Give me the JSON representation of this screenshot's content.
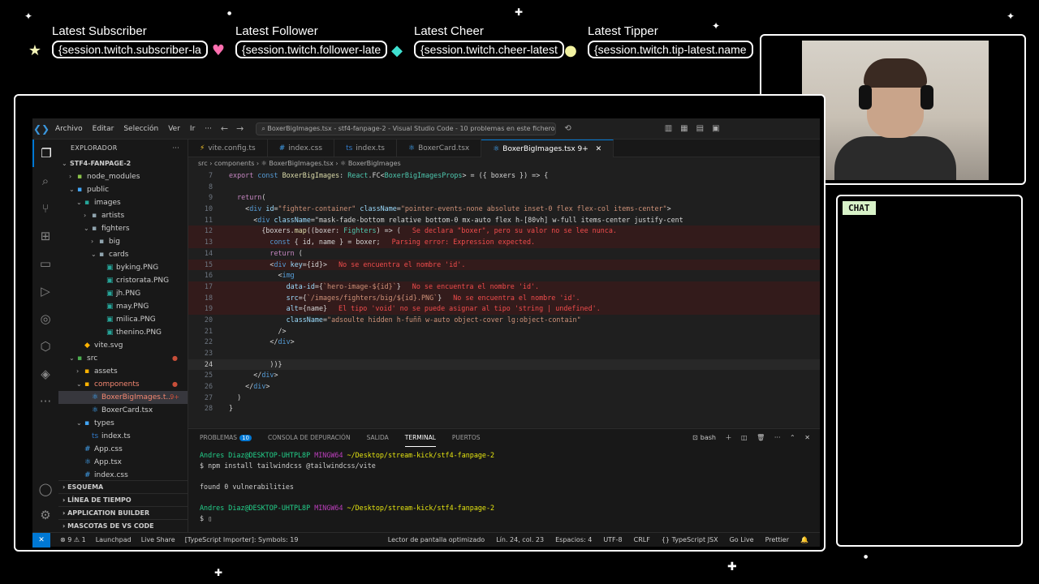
{
  "overlay": {
    "alerts": [
      {
        "label": "Latest Subscriber",
        "value": "{session.twitch.subscriber-la",
        "dot_color": "#f5f5b8",
        "dot": "★"
      },
      {
        "label": "Latest Follower",
        "value": "{session.twitch.follower-late",
        "dot_color": "#ff6fb0",
        "dot": "♥"
      },
      {
        "label": "Latest Cheer",
        "value": "{session.twitch.cheer-latest",
        "dot_color": "#3fe0d0",
        "dot": "◆"
      },
      {
        "label": "Latest Tipper",
        "value": "{session.twitch.tip-latest.name",
        "dot_color": "#f2f2a0",
        "dot": "●"
      }
    ],
    "chat_title": "CHAT"
  },
  "vscode": {
    "menu": [
      "Archivo",
      "Editar",
      "Selección",
      "Ver",
      "Ir",
      "···"
    ],
    "search": "BoxerBigImages.tsx - stf4-fanpage-2 - Visual Studio Code - 10 problemas en este fichero",
    "explorer_title": "EXPLORADOR",
    "tree": [
      {
        "depth": 0,
        "chev": "⌄",
        "icon": "",
        "label": "STF4-FANPAGE-2",
        "bold": true
      },
      {
        "depth": 1,
        "chev": "›",
        "icon": "▪",
        "label": "node_modules",
        "color": "#8bc34a"
      },
      {
        "depth": 1,
        "chev": "⌄",
        "icon": "▪",
        "label": "public",
        "color": "#42a5f5"
      },
      {
        "depth": 2,
        "chev": "⌄",
        "icon": "▪",
        "label": "images",
        "color": "#26a69a"
      },
      {
        "depth": 3,
        "chev": "›",
        "icon": "▪",
        "label": "artists",
        "color": "#90a4ae"
      },
      {
        "depth": 3,
        "chev": "⌄",
        "icon": "▪",
        "label": "fighters",
        "color": "#90a4ae"
      },
      {
        "depth": 4,
        "chev": "›",
        "icon": "▪",
        "label": "big",
        "color": "#90a4ae"
      },
      {
        "depth": 4,
        "chev": "⌄",
        "icon": "▪",
        "label": "cards",
        "color": "#90a4ae"
      },
      {
        "depth": 5,
        "chev": "",
        "icon": "▣",
        "label": "byking.PNG",
        "color": "#26a69a"
      },
      {
        "depth": 5,
        "chev": "",
        "icon": "▣",
        "label": "cristorata.PNG",
        "color": "#26a69a"
      },
      {
        "depth": 5,
        "chev": "",
        "icon": "▣",
        "label": "jh.PNG",
        "color": "#26a69a"
      },
      {
        "depth": 5,
        "chev": "",
        "icon": "▣",
        "label": "may.PNG",
        "color": "#26a69a"
      },
      {
        "depth": 5,
        "chev": "",
        "icon": "▣",
        "label": "milica.PNG",
        "color": "#26a69a"
      },
      {
        "depth": 5,
        "chev": "",
        "icon": "▣",
        "label": "thenino.PNG",
        "color": "#26a69a"
      },
      {
        "depth": 2,
        "chev": "",
        "icon": "◆",
        "label": "vite.svg",
        "color": "#ffb300"
      },
      {
        "depth": 1,
        "chev": "⌄",
        "icon": "▪",
        "label": "src",
        "color": "#4caf50",
        "dot": true
      },
      {
        "depth": 2,
        "chev": "›",
        "icon": "▪",
        "label": "assets",
        "color": "#ffb300"
      },
      {
        "depth": 2,
        "chev": "⌄",
        "icon": "▪",
        "label": "components",
        "color": "#ffb300",
        "dot": true,
        "labelColor": "#f48771"
      },
      {
        "depth": 3,
        "chev": "",
        "icon": "⚛",
        "label": "BoxerBigImages.t...",
        "color": "#42a5f5",
        "badge": "9+",
        "selected": true,
        "labelColor": "#f48771"
      },
      {
        "depth": 3,
        "chev": "",
        "icon": "⚛",
        "label": "BoxerCard.tsx",
        "color": "#42a5f5"
      },
      {
        "depth": 2,
        "chev": "⌄",
        "icon": "▪",
        "label": "types",
        "color": "#42a5f5"
      },
      {
        "depth": 3,
        "chev": "",
        "icon": "ts",
        "label": "index.ts",
        "color": "#3178c6"
      },
      {
        "depth": 2,
        "chev": "",
        "icon": "#",
        "label": "App.css",
        "color": "#42a5f5"
      },
      {
        "depth": 2,
        "chev": "",
        "icon": "⚛",
        "label": "App.tsx",
        "color": "#42a5f5"
      },
      {
        "depth": 2,
        "chev": "",
        "icon": "#",
        "label": "index.css",
        "color": "#42a5f5"
      }
    ],
    "sections": [
      "ESQUEMA",
      "LÍNEA DE TIEMPO",
      "APPLICATION BUILDER",
      "MASCOTAS DE VS CODE"
    ],
    "tabs": [
      {
        "icon": "⚡",
        "icon_color": "#ffca28",
        "label": "vite.config.ts"
      },
      {
        "icon": "#",
        "icon_color": "#42a5f5",
        "label": "index.css"
      },
      {
        "icon": "ts",
        "icon_color": "#3178c6",
        "label": "index.ts"
      },
      {
        "icon": "⚛",
        "icon_color": "#42a5f5",
        "label": "BoxerCard.tsx"
      },
      {
        "icon": "⚛",
        "icon_color": "#42a5f5",
        "label": "BoxerBigImages.tsx 9+",
        "active": true,
        "close": "✕"
      }
    ],
    "breadcrumb": "src › components › ⚛ BoxerBigImages.tsx › ⚛ BoxerBigImages",
    "editor_lines": [
      {
        "n": "7",
        "code": "export const BoxerBigImages: React.FC<BoxerBigImagesProps> = ({ boxers }) => {",
        "err": ""
      },
      {
        "n": "8",
        "code": "",
        "err": ""
      },
      {
        "n": "9",
        "code": "  return(",
        "err": ""
      },
      {
        "n": "10",
        "code": "    <div id=\"fighter-container\" className=\"pointer-events-none absolute inset-0 flex flex-col items-center\">",
        "err": ""
      },
      {
        "n": "11",
        "code": "      <div className=\"mask-fade-bottom relative bottom-0 mx-auto flex h-[80vh] w-full items-center justify-cent",
        "err": ""
      },
      {
        "n": "12",
        "code": "        {boxers.map((boxer: Fighters) => (",
        "err": "Se declara \"boxer\", pero su valor no se lee nunca."
      },
      {
        "n": "13",
        "code": "          const { id, name } = boxer;",
        "err": "Parsing error: Expression expected."
      },
      {
        "n": "14",
        "code": "          return (",
        "err": ""
      },
      {
        "n": "15",
        "code": "          <div key={id}>",
        "err": "No se encuentra el nombre 'id'."
      },
      {
        "n": "16",
        "code": "            <img",
        "err": ""
      },
      {
        "n": "17",
        "code": "              data-id={`hero-image-${id}`}",
        "err": "No se encuentra el nombre 'id'."
      },
      {
        "n": "18",
        "code": "              src={`/images/fighters/big/${id}.PNG`}",
        "err": "No se encuentra el nombre 'id'."
      },
      {
        "n": "19",
        "code": "              alt={name}",
        "err": "El tipo 'void' no se puede asignar al tipo 'string | undefined'."
      },
      {
        "n": "20",
        "code": "              className=\"adsoulte hidden h-fuññ w-auto object-cover lg:object-contain\"",
        "err": ""
      },
      {
        "n": "21",
        "code": "            />",
        "err": ""
      },
      {
        "n": "22",
        "code": "          </div>",
        "err": ""
      },
      {
        "n": "23",
        "code": "",
        "err": ""
      },
      {
        "n": "24",
        "code": "          ))}",
        "err": "",
        "current": true
      },
      {
        "n": "25",
        "code": "      </div>",
        "err": ""
      },
      {
        "n": "26",
        "code": "    </div>",
        "err": ""
      },
      {
        "n": "27",
        "code": "  )",
        "err": ""
      },
      {
        "n": "28",
        "code": "}",
        "err": ""
      }
    ],
    "panel_tabs": [
      {
        "label": "PROBLEMAS",
        "count": "10"
      },
      {
        "label": "CONSOLA DE DEPURACIÓN"
      },
      {
        "label": "SALIDA"
      },
      {
        "label": "TERMINAL",
        "active": true
      },
      {
        "label": "PUERTOS"
      }
    ],
    "shell": "bash",
    "terminal": {
      "user": "Andres Diaz@DESKTOP-UHTPL8P",
      "env": "MINGW64",
      "path": "~/Desktop/stream-kick/stf4-fanpage-2",
      "command": "$ npm install tailwindcss @tailwindcss/vite",
      "result": "found 0 vulnerabilities",
      "prompt": "$ "
    },
    "status": {
      "left": [
        "⊗ 9 ⚠ 1",
        "Launchpad",
        "Live Share",
        "[TypeScript Importer]: Symbols: 19"
      ],
      "right": [
        "Lector de pantalla optimizado",
        "Lín. 24, col. 23",
        "Espacios: 4",
        "UTF-8",
        "CRLF",
        "{} TypeScript JSX",
        "Go Live",
        "Prettier"
      ]
    }
  }
}
